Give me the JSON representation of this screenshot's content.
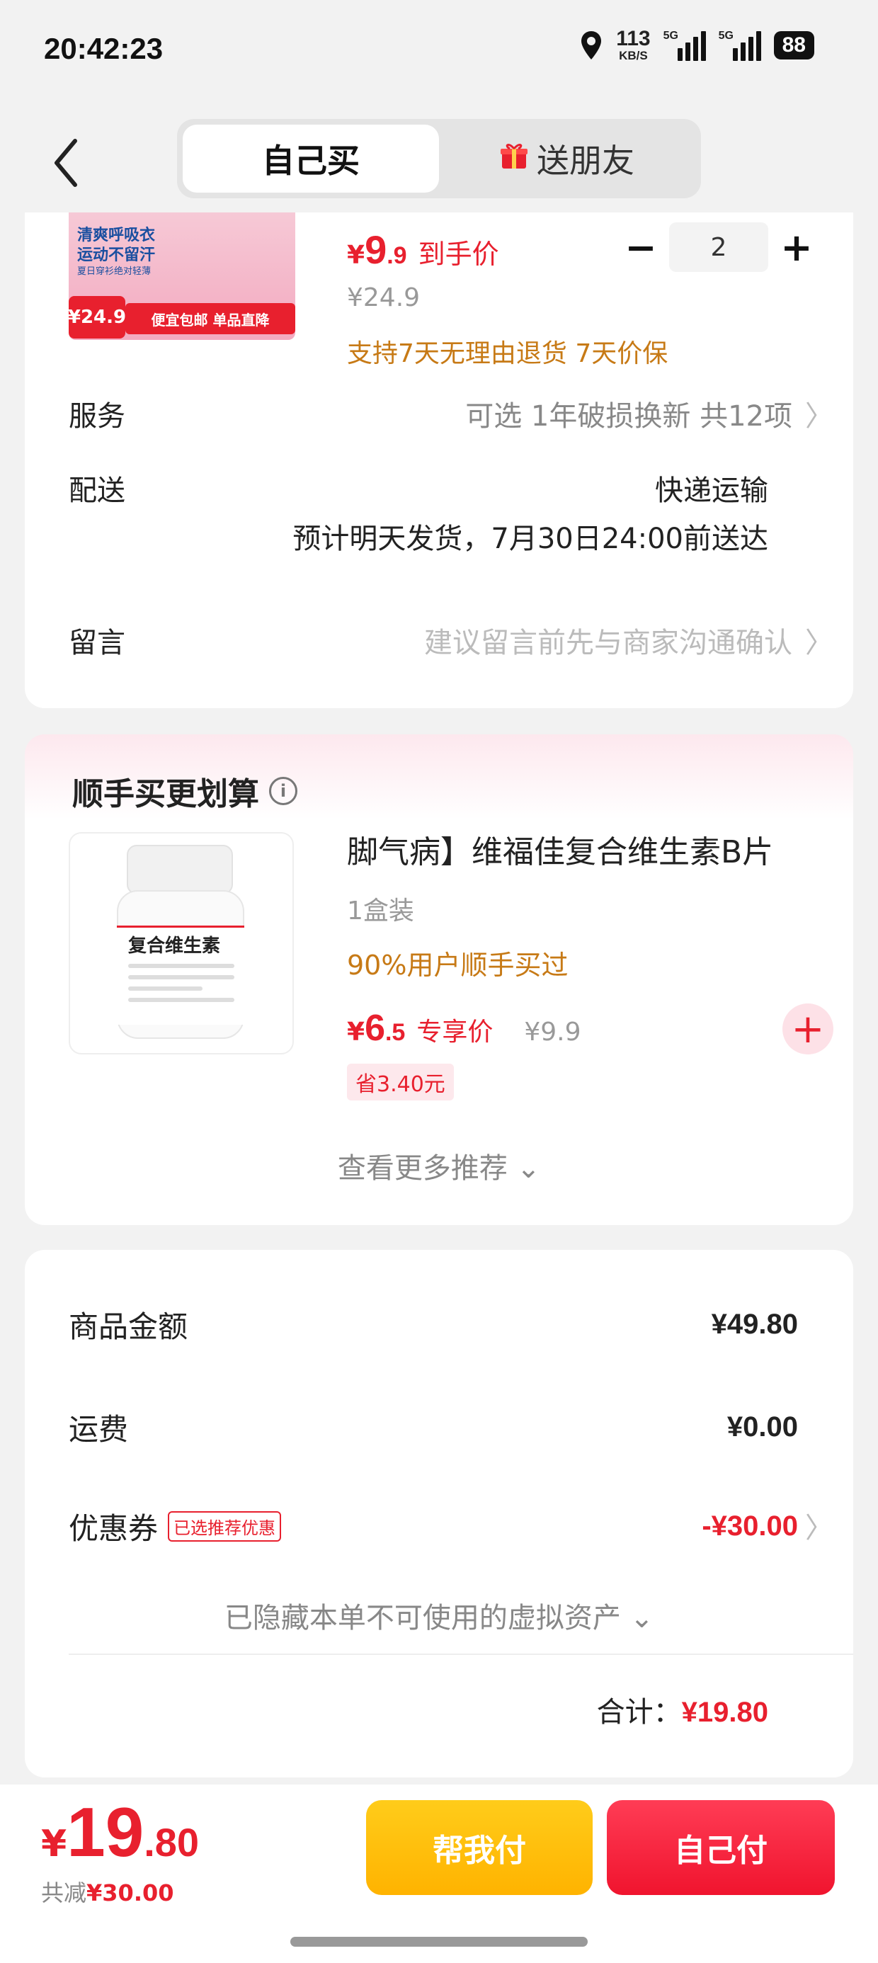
{
  "status": {
    "time": "20:42:23",
    "speed_value": "113",
    "speed_unit": "KB/S",
    "sim1": "5G",
    "sim2": "5G",
    "battery": "88"
  },
  "header": {
    "tabs": [
      {
        "label": "自己买",
        "active": true
      },
      {
        "label": "送朋友",
        "active": false
      }
    ]
  },
  "product": {
    "image_text_line1": "清爽呼吸衣",
    "image_text_line2": "运动不留汗",
    "image_text_line3": "夏日穿衫绝对轻薄",
    "image_badge": "¥24.9",
    "image_banner": "便宜包邮 单品直降",
    "price_yen": "¥",
    "price_int": "9",
    "price_dec": ".9",
    "price_label": "到手价",
    "original_price": "¥24.9",
    "promise": "支持7天无理由退货 7天价保",
    "quantity": "2",
    "minus": "−",
    "plus": "+"
  },
  "options": {
    "service_label": "服务",
    "service_value": "可选 1年破损换新 共12项",
    "delivery_label": "配送",
    "delivery_method": "快递运输",
    "delivery_eta": "预计明天发货，7月30日24:00前送达",
    "note_label": "留言",
    "note_placeholder": "建议留言前先与商家沟通确认"
  },
  "recommend": {
    "title": "顺手买更划算",
    "info_icon": "i",
    "bottle_label": "复合维生素",
    "name": "脚气病】维福佳复合维生素B片",
    "spec": "1盒装",
    "social_proof": "90%用户顺手买过",
    "price_yen": "¥",
    "price_int": "6",
    "price_dec": ".5",
    "price_label": "专享价",
    "original_price": "¥9.9",
    "save": "省3.40元",
    "add": "+",
    "more": "查看更多推荐 ⌄"
  },
  "summary": {
    "goods_label": "商品金额",
    "goods_value": "¥49.80",
    "shipping_label": "运费",
    "shipping_value": "¥0.00",
    "coupon_label": "优惠券",
    "coupon_tag": "已选推荐优惠",
    "coupon_value": "-¥30.00",
    "hidden_assets": "已隐藏本单不可使用的虚拟资产 ⌄",
    "total_label": "合计：",
    "total_value": "¥19.80"
  },
  "bottom": {
    "yen": "¥",
    "total_int": "19",
    "total_dec": ".80",
    "saved_prefix": "共减",
    "saved_value": "¥30.00",
    "help_pay": "帮我付",
    "self_pay": "自己付"
  },
  "colors": {
    "accent_red": "#e8202e",
    "gold": "#c77a16",
    "help_btn": "#ffb300",
    "pay_btn": "#f0142e"
  }
}
